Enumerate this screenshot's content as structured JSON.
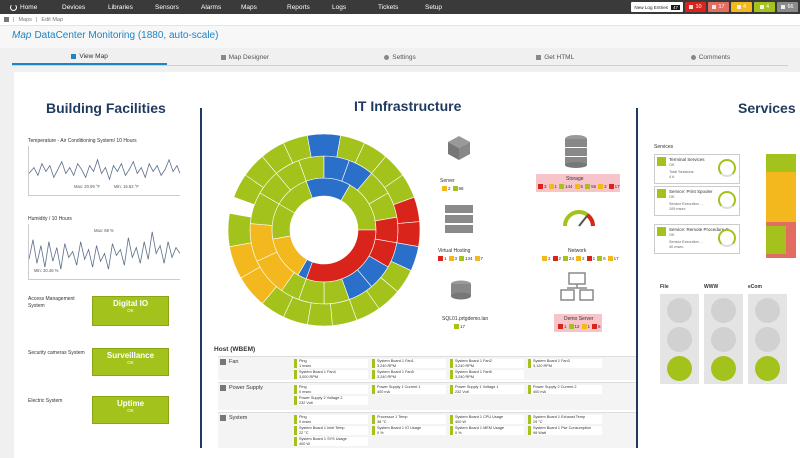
{
  "nav": {
    "home": "Home",
    "items": [
      "Devices",
      "Libraries",
      "Sensors",
      "Alarms",
      "Maps",
      "Reports",
      "Logs",
      "Tickets",
      "Setup"
    ],
    "new_log_label": "New Log Entries",
    "new_log_count": "47",
    "badges": [
      {
        "value": "10",
        "color": "#d9241c"
      },
      {
        "value": "17",
        "color": "#e26e63"
      },
      {
        "value": "4",
        "color": "#f2b81e"
      },
      {
        "value": "4",
        "color": "#a3c31c"
      },
      {
        "value": "66",
        "color": "#8a8a8a"
      }
    ]
  },
  "breadcrumb": [
    "Maps",
    "Edit Map"
  ],
  "page": {
    "title_prefix": "Map",
    "title": "DataCenter Monitoring (1880, auto-scale)"
  },
  "tabs": [
    "View Map",
    "Map Designer",
    "Settings",
    "Get HTML",
    "Comments"
  ],
  "building": {
    "title": "Building Facilities",
    "temp_label": "Temperature - Air Conditioning System/ 10 Hours",
    "temp_max": "Max: 20.09 °F",
    "temp_min": "Min: 15.62 °F",
    "humidity_label": "Humidity / 10 Hours",
    "hum_max": "Max: 68 %",
    "hum_min": "Min: 20.46 %",
    "rows": [
      {
        "label": "Access Management System",
        "box": "Digital IO",
        "status": "OK"
      },
      {
        "label": "Security cameras System",
        "box": "Surveillance",
        "status": "OK"
      },
      {
        "label": "Electric System",
        "box": "Uptime",
        "status": "OK"
      }
    ]
  },
  "it": {
    "title": "IT Infrastructure",
    "server": {
      "label": "Server",
      "counts": [
        "2",
        "98"
      ]
    },
    "storage": {
      "label": "Storage",
      "counts": [
        "3",
        "1",
        "144",
        "5",
        "55",
        "2",
        "17"
      ]
    },
    "vhost": {
      "label": "Virtual Hosting",
      "counts": [
        "1",
        "3",
        "134",
        "7"
      ]
    },
    "network": {
      "label": "Network",
      "counts": [
        "2",
        "2",
        "24",
        "2",
        "1",
        "6",
        "17"
      ]
    },
    "sql": {
      "label": "SQL01.prtgdemo.lan",
      "counts": [
        "17"
      ]
    },
    "demo": {
      "label": "Demo Server",
      "counts": [
        "1",
        "12",
        "1",
        "6"
      ]
    }
  },
  "host": {
    "title": "Host (WBEM)",
    "rows": [
      {
        "name": "Fan",
        "sensors": [
          {
            "name": "Ping",
            "value": "1 msec"
          },
          {
            "name": "System Board 1 Fan1",
            "value": "3,240 RPM"
          },
          {
            "name": "System Board 1 Fan2",
            "value": "3,240 RPM"
          },
          {
            "name": "System Board 1 Fan3",
            "value": "3,120 RPM"
          },
          {
            "name": "System Board 1 Fan4",
            "value": "3,000 RPM"
          },
          {
            "name": "System Board 1 Fan5",
            "value": "3,240 RPM"
          },
          {
            "name": "System Board 1 Fan6",
            "value": "3,240 RPM"
          }
        ]
      },
      {
        "name": "Power Supply",
        "sensors": [
          {
            "name": "Ping",
            "value": "0 msec"
          },
          {
            "name": "Power Supply 1 Current 1",
            "value": "400 mA"
          },
          {
            "name": "Power Supply 1 Voltage 1",
            "value": "232 Volt"
          },
          {
            "name": "Power Supply 2 Current 2",
            "value": "400 mA"
          },
          {
            "name": "Power Supply 2 Voltage 2",
            "value": "232 Volt"
          }
        ]
      },
      {
        "name": "System",
        "sensors": [
          {
            "name": "Ping",
            "value": "0 msec"
          },
          {
            "name": "Processor 1 Temp",
            "value": "38 °C"
          },
          {
            "name": "System Board 1 CPU Usage",
            "value": "400 W"
          },
          {
            "name": "System Board 1 Exhaust Temp",
            "value": "29 °C"
          },
          {
            "name": "System Board 1 Inlet Temp",
            "value": "22 °C"
          },
          {
            "name": "System Board 1 IO Usage",
            "value": "0 %"
          },
          {
            "name": "System Board 1 MEM Usage",
            "value": "0 %"
          },
          {
            "name": "System Board 1 Pwr Consumption",
            "value": "98 Watt"
          },
          {
            "name": "System Board 1 SYS Usage",
            "value": "400 W"
          }
        ]
      }
    ]
  },
  "services": {
    "title": "Services",
    "group": "Services",
    "cards": [
      {
        "name": "Terminal Services",
        "status": "OK",
        "sub": "Total Sessions",
        "val": "4 #"
      },
      {
        "name": "Service: Print Spooler",
        "status": "OK",
        "sub": "Sensor Execution ...",
        "val": "109 msec"
      },
      {
        "name": "Service: Remote Procedure C...",
        "status": "OK",
        "sub": "Sensor Execution ...",
        "val": "40 msec"
      }
    ],
    "lights": [
      {
        "label": "File",
        "on": 2
      },
      {
        "label": "WWW",
        "on": 2
      },
      {
        "label": "eCom",
        "on": 2
      }
    ]
  },
  "colors": {
    "green": "#a3c31c",
    "red": "#d9241c",
    "yellow": "#f2b81e",
    "blue": "#2a6fc9",
    "navy": "#1f3a5f",
    "accent": "#1d84c6"
  }
}
